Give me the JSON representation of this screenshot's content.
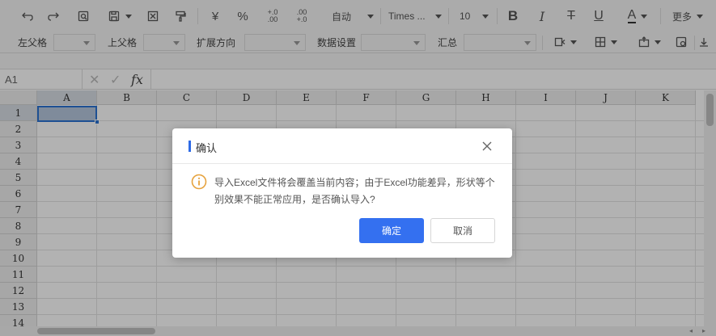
{
  "toolbar": {
    "currency": "¥",
    "percent": "%",
    "dec_inc": "+.0 .00",
    "dec_dec": ".00 +.0",
    "format": "自动",
    "font": "Times ...",
    "size": "10",
    "bold": "B",
    "italic": "I",
    "strike": "T",
    "underline": "U",
    "fontcolor": "A",
    "more": "更多"
  },
  "toolbar2": {
    "left_parent": "左父格",
    "top_parent": "上父格",
    "expand_dir": "扩展方向",
    "data_settings": "数据设置",
    "summary": "汇总"
  },
  "formula_bar": {
    "cell_ref": "A1",
    "cancel": "✕",
    "confirm": "✓",
    "fx": "fx"
  },
  "sheet": {
    "columns": [
      "A",
      "B",
      "C",
      "D",
      "E",
      "F",
      "G",
      "H",
      "I",
      "J",
      "K"
    ],
    "rows": [
      "1",
      "2",
      "3",
      "4",
      "5",
      "6",
      "7",
      "8",
      "9",
      "10",
      "11",
      "12",
      "13",
      "14"
    ]
  },
  "dialog": {
    "title": "确认",
    "message": "导入Excel文件将会覆盖当前内容；由于Excel功能差异，形状等个别效果不能正常应用，是否确认导入?",
    "ok": "确定",
    "cancel": "取消"
  },
  "colors": {
    "accent": "#3470f0",
    "warning": "#e6a23c",
    "selection": "#2b73d3"
  }
}
